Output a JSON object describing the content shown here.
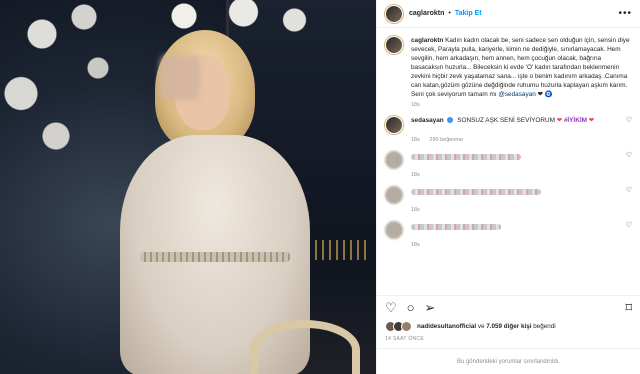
{
  "post": {
    "username": "caglaroktn",
    "follow_label": "Takip Et",
    "separator": "•",
    "more_label": "•••"
  },
  "caption": {
    "username": "caglaroktn",
    "text": "Kadın kadın olacak be, seni sadece sen olduğun için, sensin diye sevecek, Parayla pulla, kariyerle, kimin ne dediğiyle, sınırlamayacak. Hem sevgilin, hem arkadaşın, hem annen, hem çocuğun olacak, bağrına basacaksın huzurla... Bileceksin ki evde 'O' kadın tarafından beklenmenin zevkini hiçbir zevk yaşatamaz sana... işte o benim kadınım arkadaş .Canıma can katan,gözüm gözüne değdiğinde ruhumu huzurla kaplayan aşkım karım. Seni çok seviyorum tamam mı",
    "mention": "@sedasayan",
    "emojis": "❤ 🧿",
    "time": "18s"
  },
  "comments": [
    {
      "username": "sedasayan",
      "text": "SONSUZ AŞK SENİ SEVİYORUM",
      "highlight": "#İYİKİM",
      "heart": "❤",
      "time": "18s",
      "likes": "290 beğenme"
    }
  ],
  "redacted_comments": [
    {
      "time": "18s"
    },
    {
      "time": "18s"
    },
    {
      "time": "18s"
    }
  ],
  "actions": {
    "like_icon": "♡",
    "comment_icon": "○",
    "share_icon": "➢",
    "bookmark_icon": "⌑"
  },
  "likes": {
    "user": "nadidesultanofficial",
    "connector": "ve",
    "count": "7.059 diğer kişi",
    "suffix": "beğendi"
  },
  "timestamp": "14 SAAT ÖNCE",
  "limited_notice": "Bu gönderideki yorumlar sınırlandırıldı.",
  "colors": {
    "accent": "#0095f6",
    "heart": "#ed4956",
    "muted": "#8e8e8e"
  }
}
